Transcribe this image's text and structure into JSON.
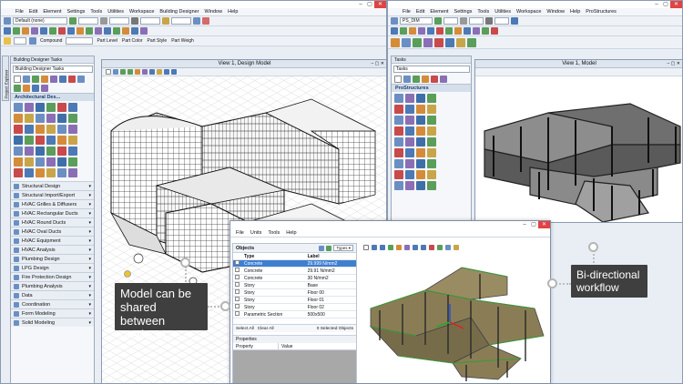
{
  "left_app": {
    "menu": [
      "File",
      "Edit",
      "Element",
      "Settings",
      "Tools",
      "Utilities",
      "Workspace",
      "Building Designer",
      "Window",
      "Help"
    ],
    "level_select": "Default (none)",
    "toolbar2": {
      "compound": "Compound",
      "part_level": "Part Level",
      "part_color": "Part Color",
      "part_style": "Part Style",
      "part_weight": "Part Weigh"
    },
    "tasks_panel": {
      "title": "Building Designer Tasks",
      "select": "Building Designer Tasks",
      "section": "Architectural Des...",
      "vertical_tab": "Project Explorer",
      "categories": [
        "Structural Design",
        "Structural Import/Export",
        "HVAC Grilles & Diffusers",
        "HVAC Rectangular Ducts",
        "HVAC Round Ducts",
        "HVAC Oval Ducts",
        "HVAC Equipment",
        "HVAC Analysis",
        "Plumbing Design",
        "LPG Design",
        "Fire Protection Design",
        "Plumbing Analysis",
        "Data",
        "Coordination",
        "Form Modeling",
        "Solid Modeling"
      ]
    },
    "view_title": "View 1, Design Model"
  },
  "right_app": {
    "menu": [
      "File",
      "Edit",
      "Element",
      "Settings",
      "Tools",
      "Utilities",
      "Workspace",
      "Window",
      "Help",
      "ProStructures"
    ],
    "level_select": "PS_DIM",
    "tasks_panel": {
      "title": "Tasks",
      "select": "Tasks",
      "section": "ProStructures"
    },
    "view_title": "View 1, Model"
  },
  "dialog": {
    "menu": [
      "File",
      "Units",
      "Tools",
      "Help"
    ],
    "objects_label": "Objects",
    "types_label": "Types",
    "columns": [
      "Type",
      "Label"
    ],
    "rows": [
      {
        "type": "Concrete",
        "label": "29.999 N/mm2",
        "selected": true
      },
      {
        "type": "Concrete",
        "label": "29.91 N/mm2",
        "selected": false
      },
      {
        "type": "Concrete",
        "label": "30 N/mm2",
        "selected": false
      },
      {
        "type": "Story",
        "label": "Base",
        "selected": false
      },
      {
        "type": "Story",
        "label": "Floor 00",
        "selected": false
      },
      {
        "type": "Story",
        "label": "Floor 01",
        "selected": false
      },
      {
        "type": "Story",
        "label": "Floor 02",
        "selected": false
      },
      {
        "type": "Parametric Section",
        "label": "500x500",
        "selected": false
      }
    ],
    "select_all": "Select All",
    "clear_all": "Clear All",
    "selected_status": "0 Selected Objects",
    "properties_label": "Properties",
    "prop_columns": [
      "Property",
      "Value"
    ]
  },
  "callouts": {
    "left": "Model can be shared between products",
    "right": "Bi-directional workflow"
  },
  "colors": {
    "accent": "#3f7fd0",
    "callout_bg": "#3f3f3f",
    "close": "#e04343",
    "desktop": "#cfd8e4"
  }
}
